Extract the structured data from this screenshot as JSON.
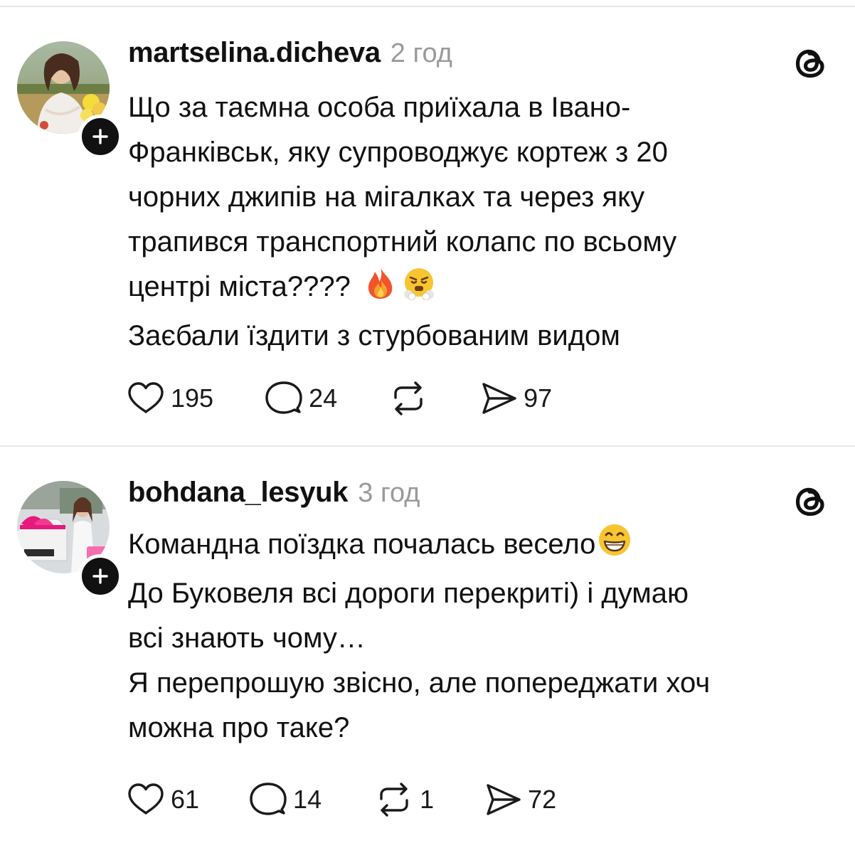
{
  "posts": [
    {
      "username": "martselina.dicheva",
      "time": "2 год",
      "lines": [
        "Що за таємна особа приїхала в Івано-",
        "Франківськ, яку супроводжує кортеж з 20",
        "чорних джипів на мігалках та через яку",
        "трапився транспортний  колапс  по всьому",
        "центрі міста????",
        "Заєбали їздити  з стурбованим видом"
      ],
      "emojis": [
        "fire-emoji",
        "steam-from-nose-emoji"
      ],
      "actions": {
        "likes": "195",
        "replies": "24",
        "reposts": "",
        "shares": "97"
      }
    },
    {
      "username": "bohdana_lesyuk",
      "time": "3 год",
      "lines": [
        "Командна поїздка почалась весело",
        "До Буковеля всі дороги перекриті) і думаю",
        "всі знають чому…",
        "Я перепрошую звісно, але попереджати хоч",
        "можна про таке?"
      ],
      "emojis": [
        "grinning-face-emoji"
      ],
      "actions": {
        "likes": "61",
        "replies": "14",
        "reposts": "1",
        "shares": "72"
      }
    }
  ],
  "icons": {
    "like": "heart-icon",
    "reply": "speech-bubble-icon",
    "repost": "repost-arrows-icon",
    "share": "send-icon",
    "brand": "threads-logo-icon",
    "follow": "plus-icon"
  },
  "colors": {
    "text": "#111111",
    "muted": "#9a9a9a",
    "divider": "#e7e7e7",
    "background": "#ffffff"
  }
}
